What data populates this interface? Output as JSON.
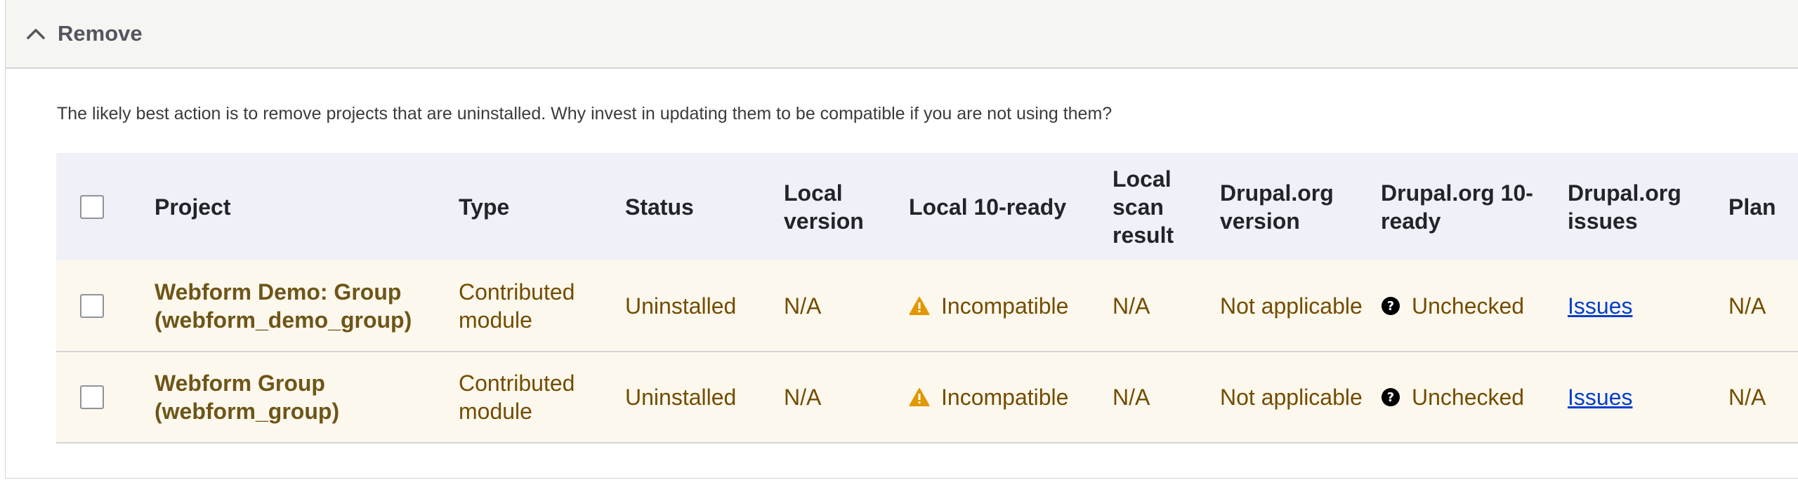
{
  "section": {
    "title": "Remove",
    "chevron_icon": "chevron-up-icon"
  },
  "intro": "The likely best action is to remove projects that are uninstalled. Why invest in updating them to be compatible if you are not using them?",
  "table": {
    "headers": {
      "project": "Project",
      "type": "Type",
      "status": "Status",
      "local_version": "Local version",
      "local_ready": "Local 10-ready",
      "local_scan": "Local scan result",
      "drupal_version": "Drupal.org version",
      "drupal_ready": "Drupal.org 10-ready",
      "drupal_issues": "Drupal.org issues",
      "plan": "Plan"
    },
    "rows": [
      {
        "project": "Webform Demo: Group (webform_demo_group)",
        "type": "Contributed module",
        "status": "Uninstalled",
        "local_version": "N/A",
        "local_ready": "Incompatible",
        "local_scan": "N/A",
        "drupal_version": "Not applicable",
        "drupal_ready": "Unchecked",
        "drupal_issues": "Issues",
        "plan": "N/A"
      },
      {
        "project": "Webform Group (webform_group)",
        "type": "Contributed module",
        "status": "Uninstalled",
        "local_version": "N/A",
        "local_ready": "Incompatible",
        "local_scan": "N/A",
        "drupal_version": "Not applicable",
        "drupal_ready": "Unchecked",
        "drupal_issues": "Issues",
        "plan": "N/A"
      }
    ]
  },
  "colors": {
    "warning": "#e29700",
    "project_text": "#6e5518",
    "link": "#003ecc"
  }
}
